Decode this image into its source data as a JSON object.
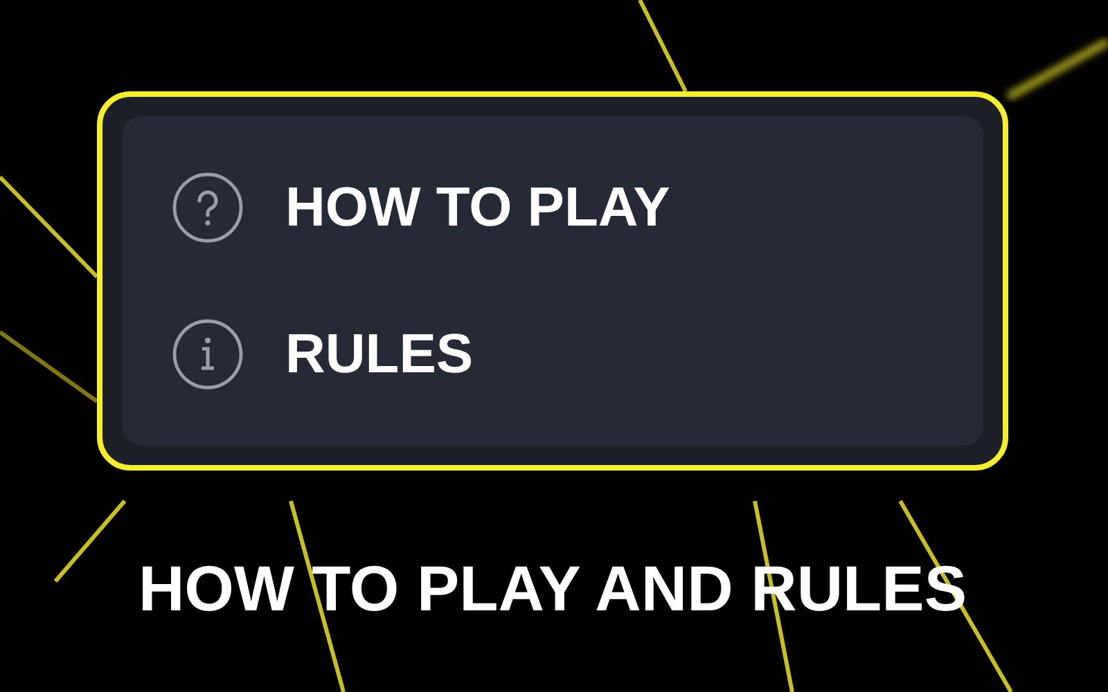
{
  "menu": {
    "items": [
      {
        "kind": "help",
        "label": "HOW TO PLAY"
      },
      {
        "kind": "info",
        "label": "RULES"
      }
    ]
  },
  "caption": "HOW TO PLAY AND RULES"
}
